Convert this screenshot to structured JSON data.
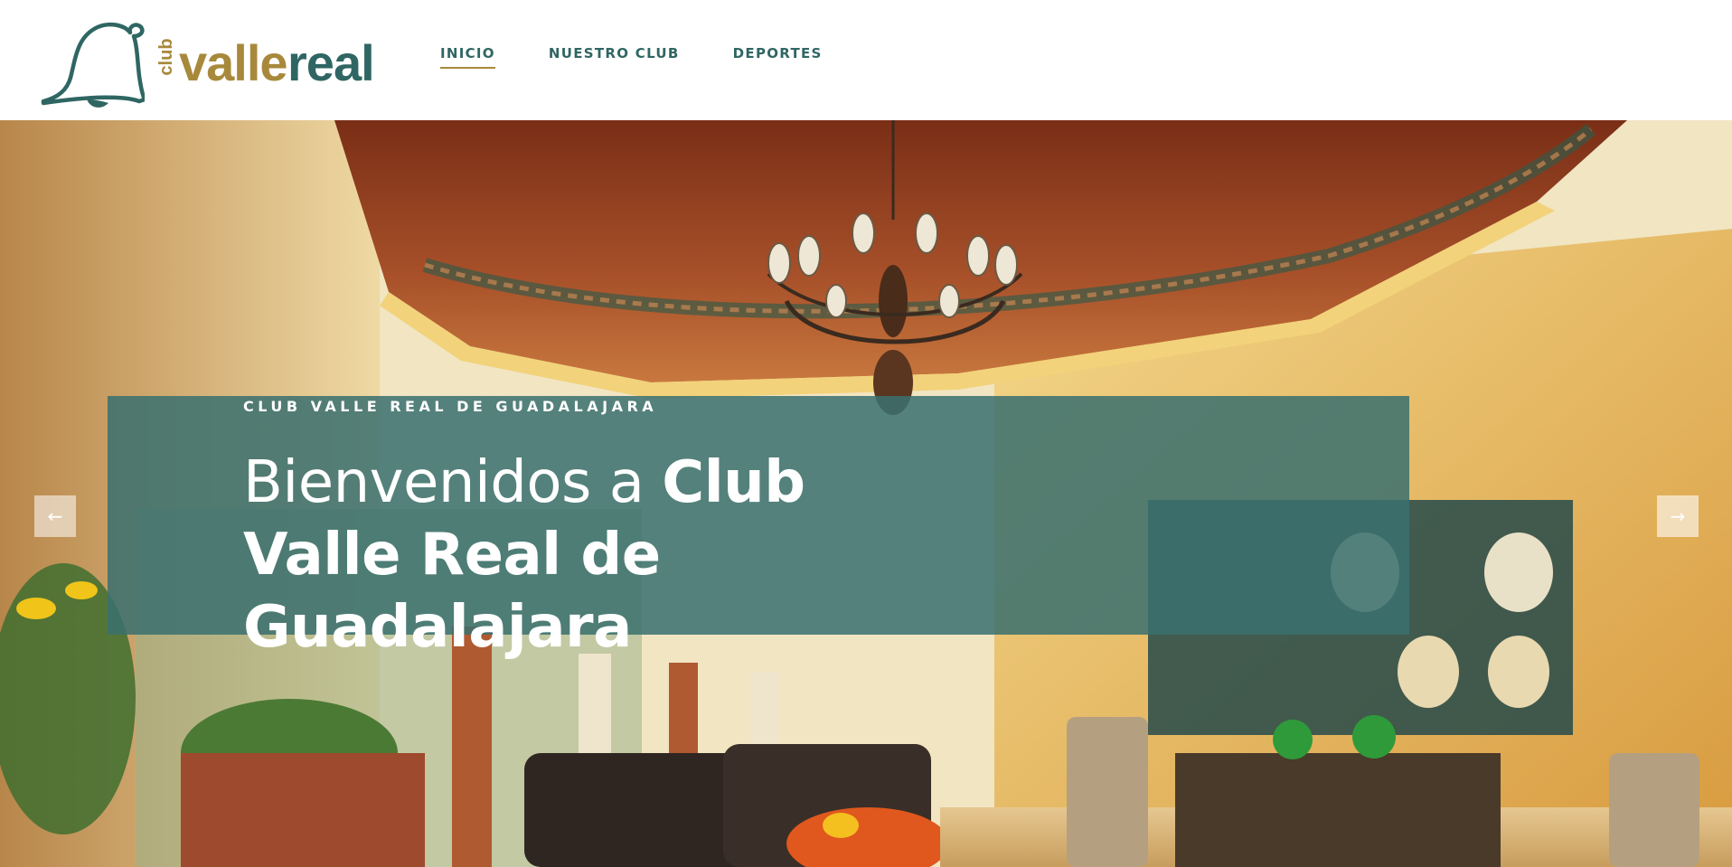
{
  "brand": {
    "logo_club": "club",
    "logo_valle": "valle",
    "logo_real": "real",
    "gold_color": "#a8893c",
    "teal_color": "#2f6663"
  },
  "nav": {
    "items": [
      {
        "label": "INICIO",
        "active": true
      },
      {
        "label": "NUESTRO CLUB",
        "active": false
      },
      {
        "label": "DEPORTES",
        "active": false
      }
    ]
  },
  "hero": {
    "eyebrow": "CLUB VALLE REAL DE GUADALAJARA",
    "headline_light": "Bienvenidos a ",
    "headline_bold": "Club Valle Real de Guadalajara",
    "prev_icon": "←",
    "next_icon": "→",
    "panel_color": "#3a706f"
  }
}
